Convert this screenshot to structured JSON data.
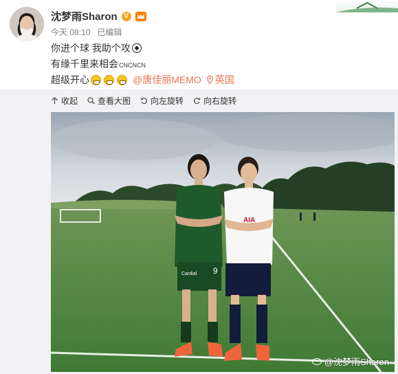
{
  "post": {
    "username": "沈梦雨Sharon",
    "verified_badge": "V",
    "time": "今天 08:10",
    "edited": "已编辑",
    "line1": "你进个球 我助个攻",
    "line2_main": "有缘千里来相会",
    "line2_small": "CNCNCN",
    "line3_main": "超级开心",
    "mention": "@唐佳丽MEMO",
    "location": "英国"
  },
  "toolbar": {
    "collect": "收起",
    "view_large": "查看大图",
    "rotate_left": "向左旋转",
    "rotate_right": "向右旋转"
  },
  "photo": {
    "watermark": "@沈梦雨Sharon",
    "jersey_number_left": "9",
    "sponsor_left": "Cardial",
    "sponsor_right": "AIA"
  },
  "colors": {
    "accent": "#eb7350",
    "panel_bg": "#f2f2f5",
    "verified": "#f5a623"
  },
  "icons": [
    "collapse-icon",
    "magnify-icon",
    "rotate-left-icon",
    "rotate-right-icon",
    "location-pin-icon",
    "soccer-ball-icon",
    "grin-emoji-icon"
  ]
}
